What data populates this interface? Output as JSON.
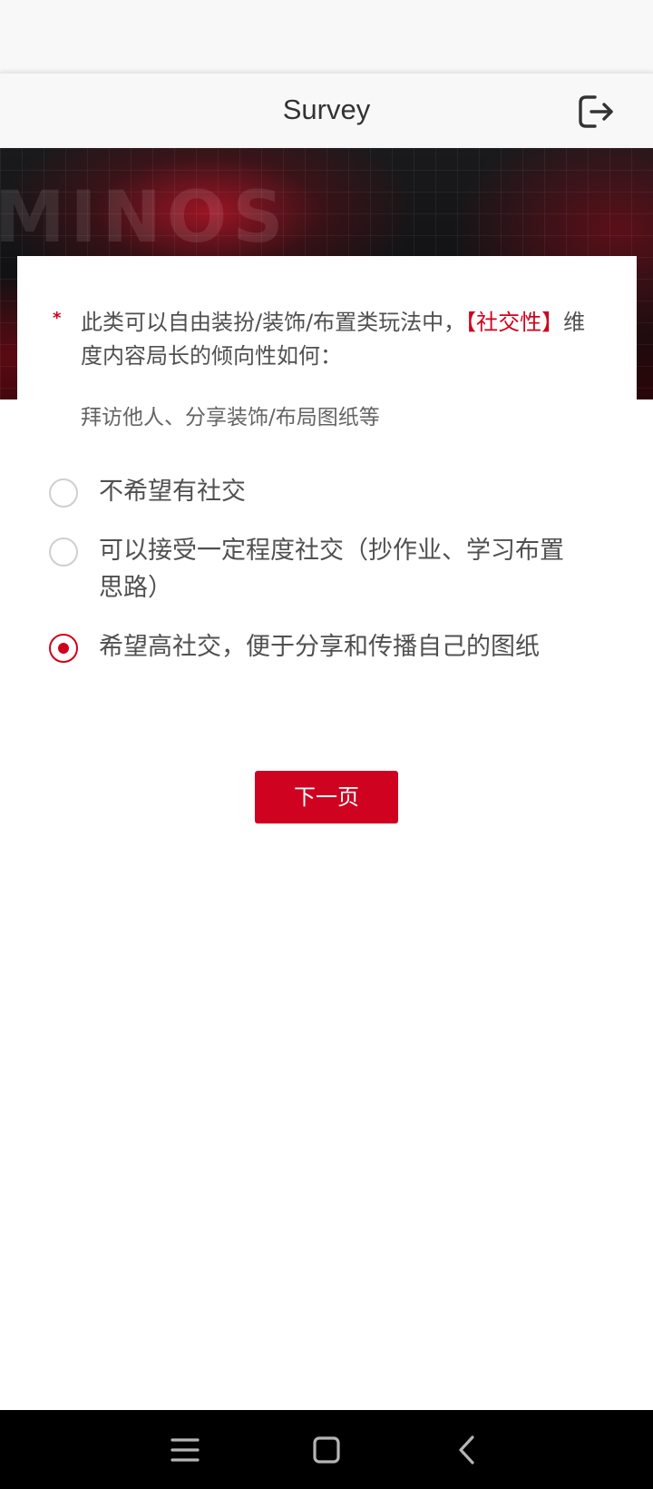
{
  "header": {
    "title": "Survey",
    "logout_icon": "logout-icon"
  },
  "banner": {
    "logo_text": "MINOS"
  },
  "question": {
    "required_mark": "*",
    "title_part1": "此类可以自由装扮/装饰/布置类玩法中，",
    "title_highlight": "【社交性】",
    "title_part2": "维度内容局长的倾向性如何：",
    "description": "拜访他人、分享装饰/布局图纸等",
    "options": [
      {
        "label": "不希望有社交",
        "selected": false
      },
      {
        "label": "可以接受一定程度社交（抄作业、学习布置思路）",
        "selected": false
      },
      {
        "label": "希望高社交，便于分享和传播自己的图纸",
        "selected": true
      }
    ]
  },
  "next_button": {
    "label": "下一页"
  },
  "nav_bar": {
    "icons": [
      "menu-icon",
      "home-square-icon",
      "back-chevron-icon"
    ]
  },
  "colors": {
    "accent": "#d0021b",
    "text": "#505050",
    "header_bg": "#f8f8f8"
  }
}
